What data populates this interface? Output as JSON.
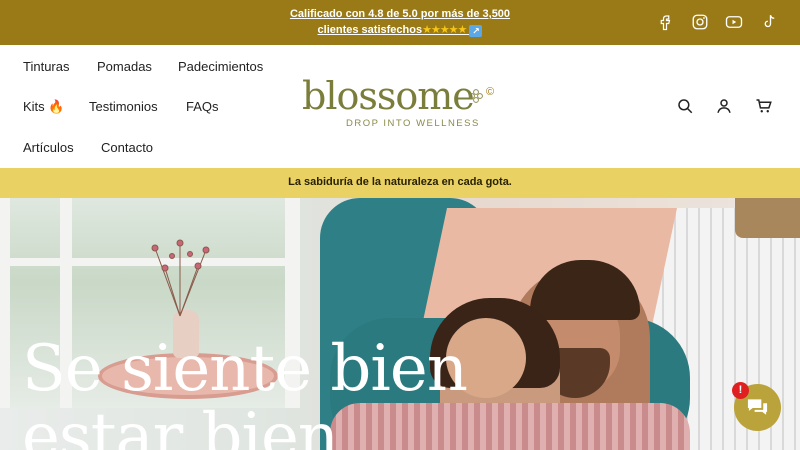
{
  "topbar": {
    "announcement_line1": "Calificado con 4.8 de 5.0 por más de 3,500",
    "announcement_line2": "clientes satisfechos",
    "stars": "★★★★★",
    "arrow": "↗",
    "social_icons": [
      "facebook-icon",
      "instagram-icon",
      "youtube-icon",
      "tiktok-icon"
    ],
    "background": "#9a7a16"
  },
  "nav": {
    "items": [
      "Tinturas",
      "Pomadas",
      "Padecimientos",
      "Kits 🔥",
      "Testimonios",
      "FAQs",
      "Artículos",
      "Contacto"
    ]
  },
  "logo": {
    "wordmark": "blossome",
    "tagline": "DROP INTO WELLNESS",
    "copyright": "©"
  },
  "header_icons": [
    "search-icon",
    "account-icon",
    "cart-icon"
  ],
  "strip": {
    "text": "La sabiduría de la naturaleza en cada gota.",
    "background": "#e9d163"
  },
  "hero": {
    "title": "Se siente bien estar bien"
  },
  "chat": {
    "badge": "!",
    "accent": "#b9a33a"
  }
}
